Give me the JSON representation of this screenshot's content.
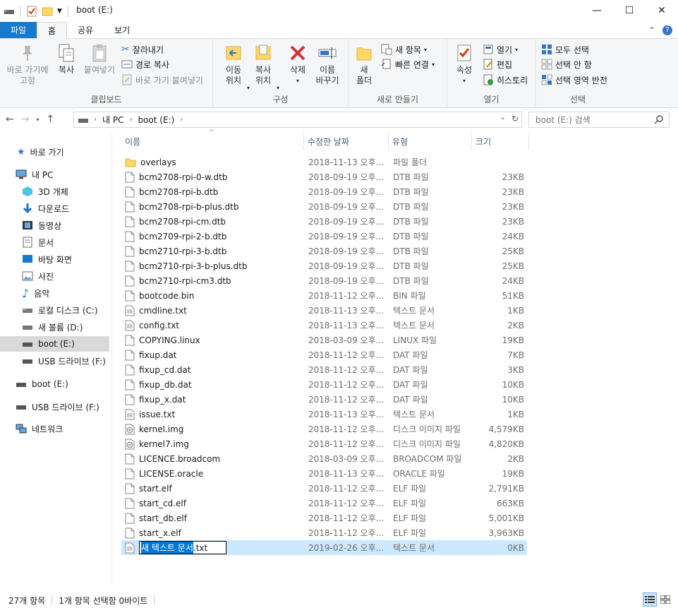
{
  "window": {
    "title": "boot (E:)",
    "minimize": "—",
    "maximize": "☐",
    "close": "✕"
  },
  "ribbon_tabs": [
    {
      "label": "파일"
    },
    {
      "label": "홈"
    },
    {
      "label": "공유"
    },
    {
      "label": "보기"
    }
  ],
  "ribbon": {
    "clipboard": {
      "label": "클립보드",
      "pin": "바로 가기에\n고정",
      "copy": "복사",
      "paste": "붙여넣기",
      "cut": "잘라내기",
      "copy_path": "경로 복사",
      "paste_shortcut": "바로 가기 붙여넣기"
    },
    "organize": {
      "label": "구성",
      "move_to": "이동\n위치",
      "copy_to": "복사\n위치",
      "delete": "삭제",
      "rename": "이름\n바꾸기"
    },
    "new": {
      "label": "새로 만들기",
      "new_folder": "새\n폴더",
      "new_item": "새 항목",
      "easy_access": "빠른 연결"
    },
    "open": {
      "label": "열기",
      "properties": "속성",
      "open": "열기",
      "edit": "편집",
      "history": "히스토리"
    },
    "select": {
      "label": "선택",
      "select_all": "모두 선택",
      "select_none": "선택 안 함",
      "invert": "선택 영역 반전"
    }
  },
  "address": {
    "path": [
      "내 PC",
      "boot (E:)"
    ],
    "search_placeholder": "boot (E:) 검색"
  },
  "nav": {
    "quick_access": "바로 가기",
    "this_pc": "내 PC",
    "items": [
      {
        "label": "3D 개체",
        "icon": "3d-objects-icon"
      },
      {
        "label": "다운로드",
        "icon": "download-icon"
      },
      {
        "label": "동영상",
        "icon": "video-icon"
      },
      {
        "label": "문서",
        "icon": "document-icon"
      },
      {
        "label": "바탕 화면",
        "icon": "desktop-icon"
      },
      {
        "label": "사진",
        "icon": "picture-icon"
      },
      {
        "label": "음악",
        "icon": "music-icon"
      },
      {
        "label": "로컬 디스크 (C:)",
        "icon": "drive-icon"
      },
      {
        "label": "새 볼륨 (D:)",
        "icon": "drive-icon"
      },
      {
        "label": "boot (E:)",
        "icon": "drive-icon"
      },
      {
        "label": "USB 드라이브 (F:)",
        "icon": "drive-icon"
      }
    ],
    "boot": "boot (E:)",
    "usb": "USB 드라이브 (F:)",
    "network": "네트워크"
  },
  "columns": {
    "name": "이름",
    "modified": "수정한 날짜",
    "type": "유형",
    "size": "크기"
  },
  "files": [
    {
      "name": "overlays",
      "date": "2018-11-13 오후...",
      "type": "파일 폴더",
      "size": "",
      "kind": "folder"
    },
    {
      "name": "bcm2708-rpi-0-w.dtb",
      "date": "2018-09-19 오후...",
      "type": "DTB 파일",
      "size": "23KB",
      "kind": "file"
    },
    {
      "name": "bcm2708-rpi-b.dtb",
      "date": "2018-09-19 오후...",
      "type": "DTB 파일",
      "size": "23KB",
      "kind": "file"
    },
    {
      "name": "bcm2708-rpi-b-plus.dtb",
      "date": "2018-09-19 오후...",
      "type": "DTB 파일",
      "size": "23KB",
      "kind": "file"
    },
    {
      "name": "bcm2708-rpi-cm.dtb",
      "date": "2018-09-19 오후...",
      "type": "DTB 파일",
      "size": "23KB",
      "kind": "file"
    },
    {
      "name": "bcm2709-rpi-2-b.dtb",
      "date": "2018-09-19 오후...",
      "type": "DTB 파일",
      "size": "24KB",
      "kind": "file"
    },
    {
      "name": "bcm2710-rpi-3-b.dtb",
      "date": "2018-09-19 오후...",
      "type": "DTB 파일",
      "size": "25KB",
      "kind": "file"
    },
    {
      "name": "bcm2710-rpi-3-b-plus.dtb",
      "date": "2018-09-19 오후...",
      "type": "DTB 파일",
      "size": "25KB",
      "kind": "file"
    },
    {
      "name": "bcm2710-rpi-cm3.dtb",
      "date": "2018-09-19 오후...",
      "type": "DTB 파일",
      "size": "24KB",
      "kind": "file"
    },
    {
      "name": "bootcode.bin",
      "date": "2018-11-12 오후...",
      "type": "BIN 파일",
      "size": "51KB",
      "kind": "file"
    },
    {
      "name": "cmdline.txt",
      "date": "2018-11-13 오후...",
      "type": "텍스트 문서",
      "size": "1KB",
      "kind": "text"
    },
    {
      "name": "config.txt",
      "date": "2018-11-13 오후...",
      "type": "텍스트 문서",
      "size": "2KB",
      "kind": "text"
    },
    {
      "name": "COPYING.linux",
      "date": "2018-03-09 오후...",
      "type": "LINUX 파일",
      "size": "19KB",
      "kind": "file"
    },
    {
      "name": "fixup.dat",
      "date": "2018-11-12 오후...",
      "type": "DAT 파일",
      "size": "7KB",
      "kind": "file"
    },
    {
      "name": "fixup_cd.dat",
      "date": "2018-11-12 오후...",
      "type": "DAT 파일",
      "size": "3KB",
      "kind": "file"
    },
    {
      "name": "fixup_db.dat",
      "date": "2018-11-12 오후...",
      "type": "DAT 파일",
      "size": "10KB",
      "kind": "file"
    },
    {
      "name": "fixup_x.dat",
      "date": "2018-11-12 오후...",
      "type": "DAT 파일",
      "size": "10KB",
      "kind": "file"
    },
    {
      "name": "issue.txt",
      "date": "2018-11-13 오후...",
      "type": "텍스트 문서",
      "size": "1KB",
      "kind": "text"
    },
    {
      "name": "kernel.img",
      "date": "2018-11-12 오후...",
      "type": "디스크 이미지 파일",
      "size": "4,579KB",
      "kind": "disc"
    },
    {
      "name": "kernel7.img",
      "date": "2018-11-12 오후...",
      "type": "디스크 이미지 파일",
      "size": "4,820KB",
      "kind": "disc"
    },
    {
      "name": "LICENCE.broadcom",
      "date": "2018-03-09 오후...",
      "type": "BROADCOM 파일",
      "size": "2KB",
      "kind": "file"
    },
    {
      "name": "LICENSE.oracle",
      "date": "2018-11-13 오후...",
      "type": "ORACLE 파일",
      "size": "19KB",
      "kind": "file"
    },
    {
      "name": "start.elf",
      "date": "2018-11-12 오후...",
      "type": "ELF 파일",
      "size": "2,791KB",
      "kind": "file"
    },
    {
      "name": "start_cd.elf",
      "date": "2018-11-12 오후...",
      "type": "ELF 파일",
      "size": "663KB",
      "kind": "file"
    },
    {
      "name": "start_db.elf",
      "date": "2018-11-12 오후...",
      "type": "ELF 파일",
      "size": "5,001KB",
      "kind": "file"
    },
    {
      "name": "start_x.elf",
      "date": "2018-11-12 오후...",
      "type": "ELF 파일",
      "size": "3,963KB",
      "kind": "file"
    }
  ],
  "new_file": {
    "name_selected": "새 텍스트 문서",
    "extension": ".txt",
    "date": "2019-02-26 오후...",
    "type": "텍스트 문서",
    "size": "0KB"
  },
  "status": {
    "item_count": "27개 항목",
    "selection": "1개 항목 선택함 0바이트"
  },
  "colors": {
    "accent": "#1979ca",
    "selection": "#cce8ff",
    "folder": "#ffd769"
  }
}
